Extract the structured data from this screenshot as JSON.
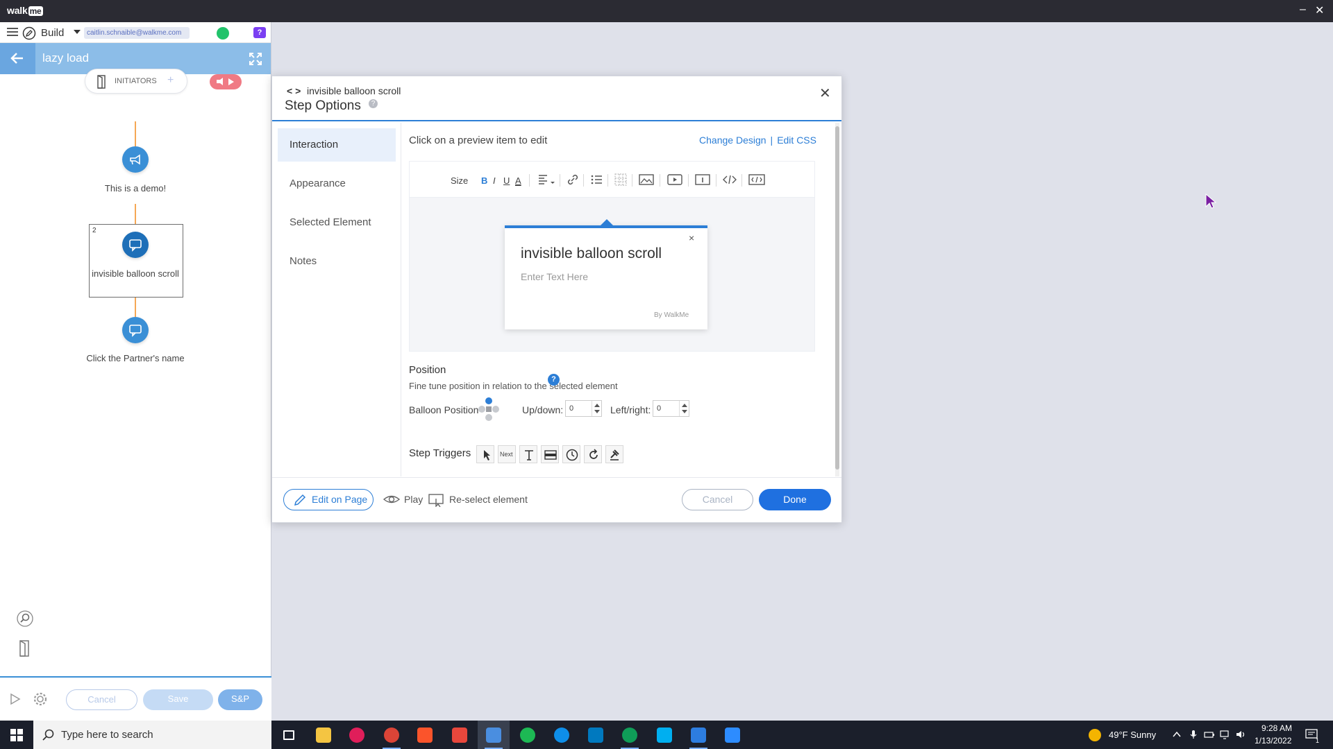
{
  "titlebar": {
    "logo_text": "walk",
    "logo_me": "me",
    "minimize": "–",
    "close": "✕"
  },
  "left_panel": {
    "build_label": "Build",
    "email": "caitlin.schnaible@walkme.com",
    "help_badge": "?",
    "flow_title": "lazy load",
    "initiators_label": "INITIATORS",
    "initiators_add": "+",
    "nodes": [
      {
        "label": "This is a demo!"
      },
      {
        "number": "2",
        "label": "invisible balloon scroll"
      },
      {
        "label": "Click the Partner's name"
      }
    ],
    "buttons": {
      "cancel": "Cancel",
      "save": "Save",
      "save_publish": "S&P"
    }
  },
  "modal": {
    "breadcrumb_arrows": "< >",
    "breadcrumb": "invisible balloon scroll",
    "title": "Step Options",
    "help": "?",
    "close": "✕",
    "tabs": [
      "Interaction",
      "Appearance",
      "Selected Element",
      "Notes"
    ],
    "active_tab": "Interaction",
    "hint": "Click on a preview item to edit",
    "change_design": "Change Design",
    "edit_css": "Edit CSS",
    "toolbar": {
      "size": "Size",
      "bold": "B",
      "italic": "I",
      "underline": "U",
      "color": "A"
    },
    "balloon": {
      "close": "×",
      "title": "invisible balloon scroll",
      "text_placeholder": "Enter Text Here",
      "by": "By WalkMe"
    },
    "position": {
      "title": "Position",
      "subtitle": "Fine tune position in relation to the selected element",
      "balloon_position_label": "Balloon Position",
      "updown_label": "Up/down:",
      "updown_value": "0",
      "leftright_label": "Left/right:",
      "leftright_value": "0"
    },
    "step_triggers": {
      "label": "Step Triggers",
      "next_label": "Next",
      "help": "?"
    },
    "footer": {
      "edit_on_page": "Edit on Page",
      "play": "Play",
      "reselect": "Re-select element",
      "cancel": "Cancel",
      "done": "Done"
    }
  },
  "taskbar": {
    "search_placeholder": "Type here to search",
    "weather": "49°F  Sunny",
    "time": "9:28 AM",
    "date": "1/13/2022",
    "notification_count": "1"
  },
  "colors": {
    "accent": "#2c7ed6",
    "header_blue": "#8cbde8",
    "done_blue": "#1f70e0",
    "flow_line": "#f5a855"
  }
}
